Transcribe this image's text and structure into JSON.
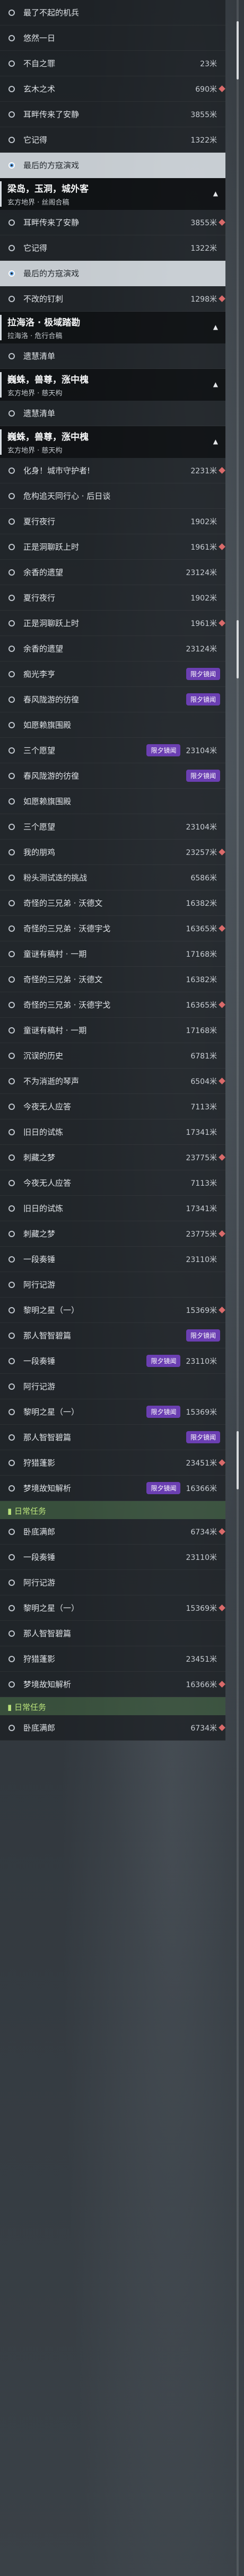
{
  "rows_group1": [
    {
      "label": "最了不起的机兵",
      "dist": ""
    },
    {
      "label": "悠然一日",
      "dist": ""
    },
    {
      "label": "不自之罪",
      "dist": "23米"
    },
    {
      "label": "玄木之术",
      "dist": "690米"
    },
    {
      "label": "耳畔传来了安静",
      "dist": "3855米"
    },
    {
      "label": "它记得",
      "dist": "1322米"
    },
    {
      "label": "最后的方寇演戏",
      "dist": "",
      "selected": true
    }
  ],
  "header1": {
    "title": "梁岛，玉洞，城外客",
    "subtitle": "玄方地界 · 丝阁合稿"
  },
  "rows_group2": [
    {
      "label": "耳畔传来了安静",
      "dist": "3855米"
    },
    {
      "label": "它记得",
      "dist": "1322米"
    },
    {
      "label": "最后的方寇演戏",
      "dist": "",
      "selected": true
    },
    {
      "label": "不改的钉刺",
      "dist": "1298米"
    }
  ],
  "header2": {
    "title": "拉海洛 · 极域踏勘",
    "subtitle": "拉海洛 · 危行合稿"
  },
  "rows_group3": [
    {
      "label": "遗慧清单",
      "dist": ""
    }
  ],
  "header3": {
    "title": "巍蛛，兽尊，涨中槐",
    "subtitle": "玄方地界 · 慈天构"
  },
  "rows_group4": [
    {
      "label": "遗慧清单",
      "dist": ""
    }
  ],
  "header4": {
    "title": "巍蛛，兽尊，涨中槐",
    "subtitle": "玄方地界 · 慈天构"
  },
  "rows_group5": [
    {
      "label": "化身！城市守护者!",
      "dist": "2231米"
    },
    {
      "label": "危构追天同行心 · 后日谈",
      "dist": ""
    },
    {
      "label": "夏行夜行",
      "dist": "1902米"
    },
    {
      "label": "正是洞聊跃上时",
      "dist": "1961米"
    },
    {
      "label": "余香的遗望",
      "dist": "23124米"
    },
    {
      "label": "夏行夜行",
      "dist": "1902米"
    },
    {
      "label": "正是洞聊跃上时",
      "dist": "1961米"
    },
    {
      "label": "余香的遗望",
      "dist": "23124米"
    },
    {
      "label": "痴光李亨",
      "dist": "",
      "tag": "限夕镜闻"
    },
    {
      "label": "春风陇游的彷徨",
      "dist": "",
      "tag": "限夕镜闻"
    },
    {
      "label": "如愿赖旗围殿",
      "dist": ""
    },
    {
      "label": "三个愿望",
      "dist": "23104米",
      "tag": "限夕镜闻"
    },
    {
      "label": "春风陇游的彷徨",
      "dist": "",
      "tag": "限夕镜闻"
    },
    {
      "label": "如愿赖旗围殿",
      "dist": ""
    },
    {
      "label": "三个愿望",
      "dist": "23104米"
    },
    {
      "label": "我的朋鸡",
      "dist": "23257米"
    },
    {
      "label": "粉头测试迭的挑战",
      "dist": "6586米"
    },
    {
      "label": "奇怪的三兄弟 · 沃德文",
      "dist": "16382米"
    },
    {
      "label": "奇怪的三兄弟 · 沃德宇戈",
      "dist": "16365米"
    },
    {
      "label": "童谜有稿村 · 一期",
      "dist": "17168米"
    },
    {
      "label": "奇怪的三兄弟 · 沃德文",
      "dist": "16382米"
    },
    {
      "label": "奇怪的三兄弟 · 沃德宇戈",
      "dist": "16365米"
    },
    {
      "label": "童谜有稿村 · 一期",
      "dist": "17168米"
    },
    {
      "label": "沉误的历史",
      "dist": "6781米"
    },
    {
      "label": "不为消逝的琴声",
      "dist": "6504米"
    },
    {
      "label": "今夜无人应答",
      "dist": "7113米"
    },
    {
      "label": "旧日的试炼",
      "dist": "17341米"
    },
    {
      "label": "刺藏之梦",
      "dist": "23775米"
    },
    {
      "label": "今夜无人应答",
      "dist": "7113米"
    },
    {
      "label": "旧日的试炼",
      "dist": "17341米"
    },
    {
      "label": "刺藏之梦",
      "dist": "23775米"
    },
    {
      "label": "一段奏锤",
      "dist": "23110米"
    },
    {
      "label": "阿行记游",
      "dist": ""
    },
    {
      "label": "黎明之星（一）",
      "dist": "15369米"
    },
    {
      "label": "那人智智碧篇",
      "dist": "",
      "tag": "限夕镜闻"
    },
    {
      "label": "一段奏锤",
      "dist": "23110米",
      "tag": "限夕镜闻"
    },
    {
      "label": "阿行记游",
      "dist": ""
    },
    {
      "label": "黎明之星（一）",
      "dist": "15369米",
      "tag": "限夕镜闻"
    },
    {
      "label": "那人智智碧篇",
      "dist": "",
      "tag": "限夕镜闻"
    },
    {
      "label": "狩猎蓬影",
      "dist": "23451米"
    },
    {
      "label": "梦境故知解析",
      "dist": "16366米",
      "tag": "限夕镜闻"
    }
  ],
  "section1": {
    "title": "日常任务"
  },
  "rows_group6": [
    {
      "label": "卧底满郎",
      "dist": "6734米"
    },
    {
      "label": "一段奏锤",
      "dist": "23110米"
    },
    {
      "label": "阿行记游",
      "dist": ""
    },
    {
      "label": "黎明之星（一）",
      "dist": "15369米"
    },
    {
      "label": "那人智智碧篇",
      "dist": ""
    },
    {
      "label": "狩猎蓬影",
      "dist": "23451米"
    },
    {
      "label": "梦境故知解析",
      "dist": "16366米"
    }
  ],
  "section2": {
    "title": "日常任务"
  },
  "rows_group7": [
    {
      "label": "卧底满郎",
      "dist": "6734米"
    }
  ],
  "icons": {
    "chevron": "chevron-up-icon",
    "ring": "quest-ring-icon",
    "marker": "quest-marker-icon"
  },
  "colors": {
    "tag": "#6b3fb2",
    "marker": "#d96a6a",
    "section": "#b9e27a"
  }
}
